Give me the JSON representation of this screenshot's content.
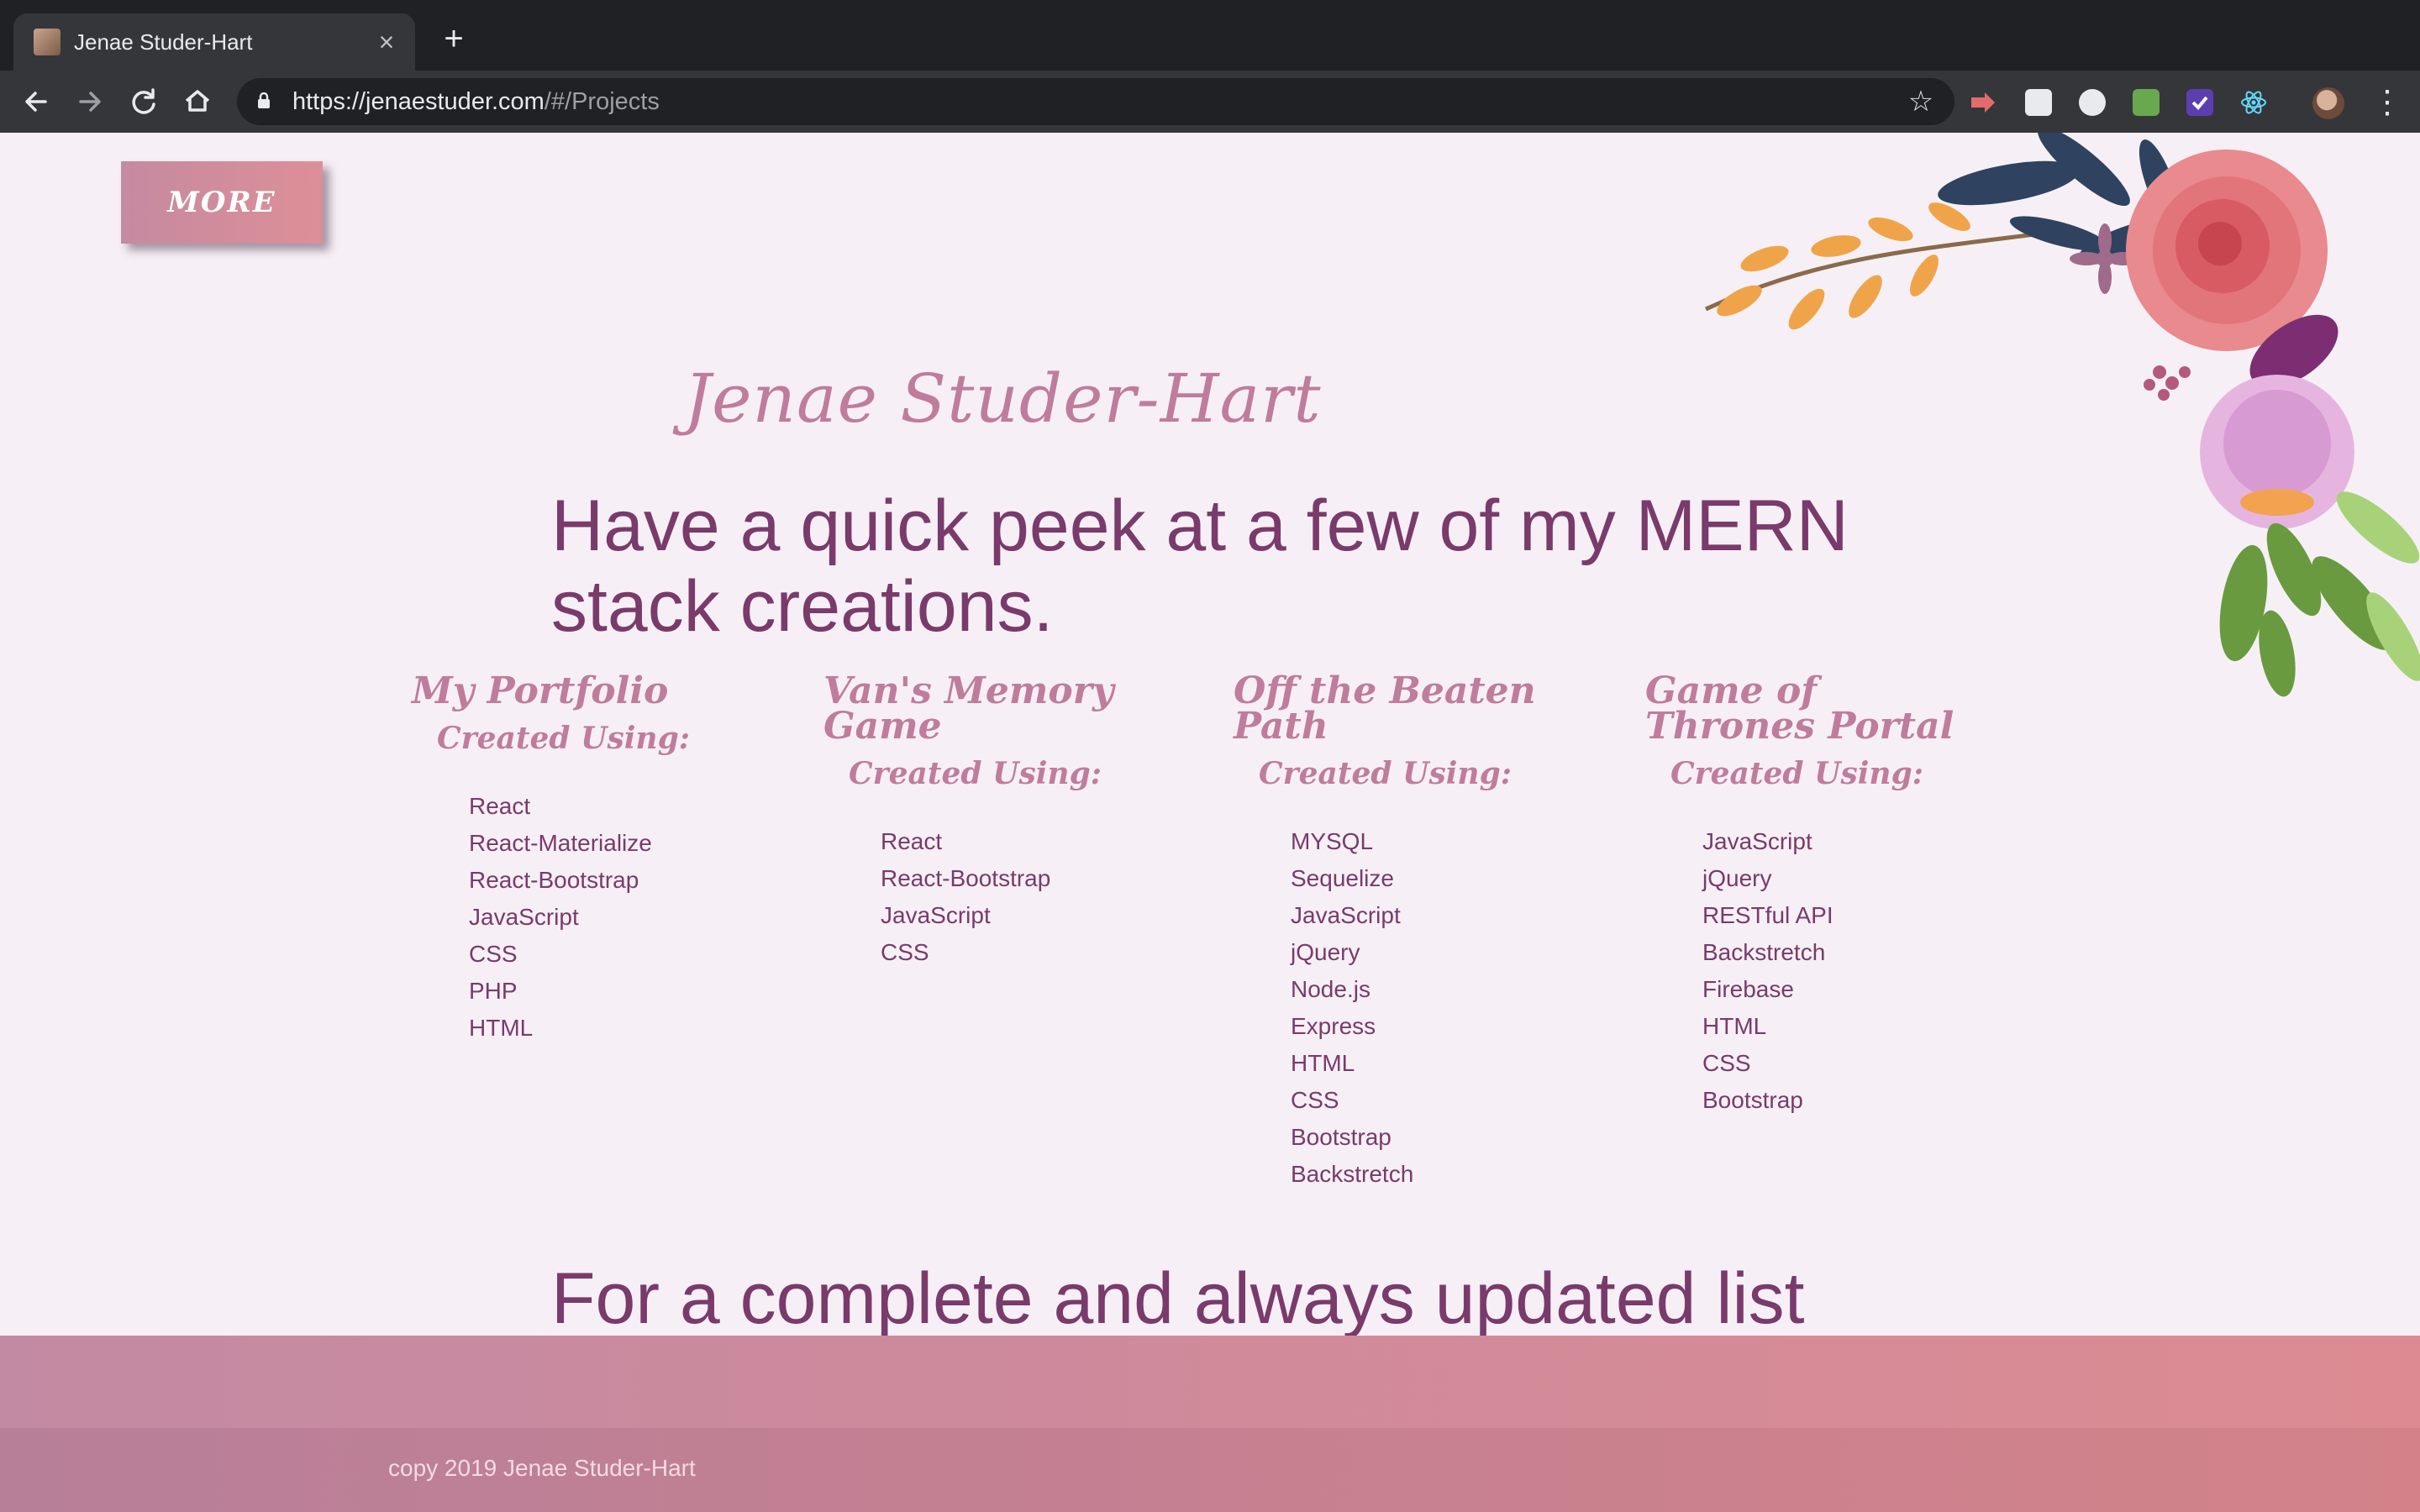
{
  "browser": {
    "tab_title": "Jenae Studer-Hart",
    "tab_close": "×",
    "new_tab": "+",
    "url_host": "https://jenaestuder.com",
    "url_path": "/#/Projects"
  },
  "page": {
    "more_button": "MORE",
    "site_title": "Jenae Studer-Hart",
    "headline": "Have a quick peek at a few of my MERN stack creations.",
    "created_label": "Created Using:",
    "projects": [
      {
        "title": "My Portfolio",
        "tech": [
          "React",
          "React-Materialize",
          "React-Bootstrap",
          "JavaScript",
          "CSS",
          "PHP",
          "HTML"
        ]
      },
      {
        "title": "Van's Memory Game",
        "tech": [
          "React",
          "React-Bootstrap",
          "JavaScript",
          "CSS"
        ]
      },
      {
        "title": "Off the Beaten Path",
        "tech": [
          "MYSQL",
          "Sequelize",
          "JavaScript",
          "jQuery",
          "Node.js",
          "Express",
          "HTML",
          "CSS",
          "Bootstrap",
          "Backstretch"
        ]
      },
      {
        "title": "Game of Thrones Portal",
        "tech": [
          "JavaScript",
          "jQuery",
          "RESTful API",
          "Backstretch",
          "Firebase",
          "HTML",
          "CSS",
          "Bootstrap"
        ]
      }
    ],
    "bottom_heading": "For a complete and always updated list",
    "footer": "copy 2019 Jenae Studer-Hart"
  },
  "colors": {
    "title_pink": "#c07c9c",
    "text_plum": "#7a3a6c",
    "page_bg": "#f6f0f6",
    "footer_left": "#c38aa3",
    "footer_right": "#dc8b92"
  }
}
